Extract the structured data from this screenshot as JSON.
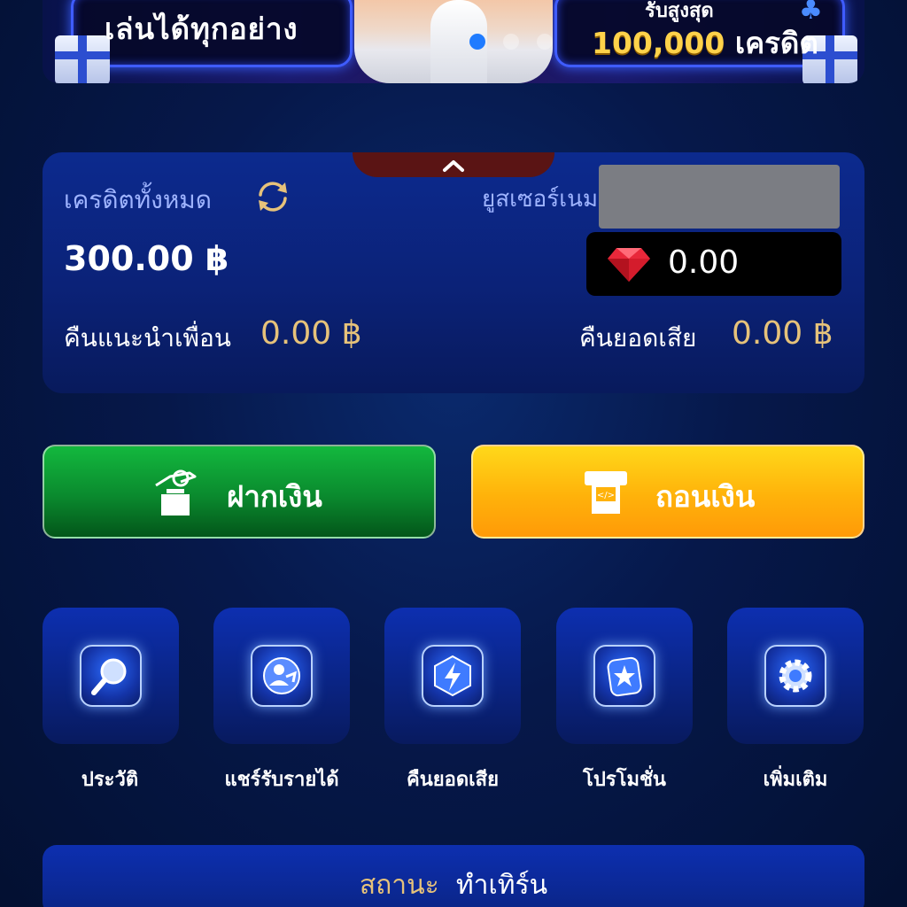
{
  "banner": {
    "left_text": "เล่นได้ทุกอย่าง",
    "right_small_text": "รับสูงสุด",
    "right_amount": "100,000",
    "right_unit": "เครดิต",
    "slide_count": 3,
    "active_slide": 1
  },
  "credit_card": {
    "credit_label": "เครดิตทั้งหมด",
    "balance": "300.00 ฿",
    "username_label": "ยูสเซอร์เนม",
    "gem_value": "0.00",
    "referral_label": "คืนแนะนำเพื่อน",
    "referral_value": "0.00 ฿",
    "loss_label": "คืนยอดเสีย",
    "loss_value": "0.00 ฿"
  },
  "actions": {
    "deposit_label": "ฝากเงิน",
    "withdraw_label": "ถอนเงิน"
  },
  "menu": [
    {
      "label": "ประวัติ",
      "icon": "search-icon"
    },
    {
      "label": "แชร์รับรายได้",
      "icon": "user-share-icon"
    },
    {
      "label": "คืนยอดเสีย",
      "icon": "lightning-icon"
    },
    {
      "label": "โปรโมชั่น",
      "icon": "star-icon"
    },
    {
      "label": "เพิ่มเติม",
      "icon": "gear-icon"
    }
  ],
  "status": {
    "label": "สถานะ",
    "value": "ทำเทิร์น"
  },
  "colors": {
    "background": "#041536",
    "card": "#0b2278",
    "gold_text": "#e6c27a",
    "deposit_green": "#0a8a2e",
    "withdraw_yellow": "#ffb20a",
    "active_dot": "#1f7bff"
  }
}
